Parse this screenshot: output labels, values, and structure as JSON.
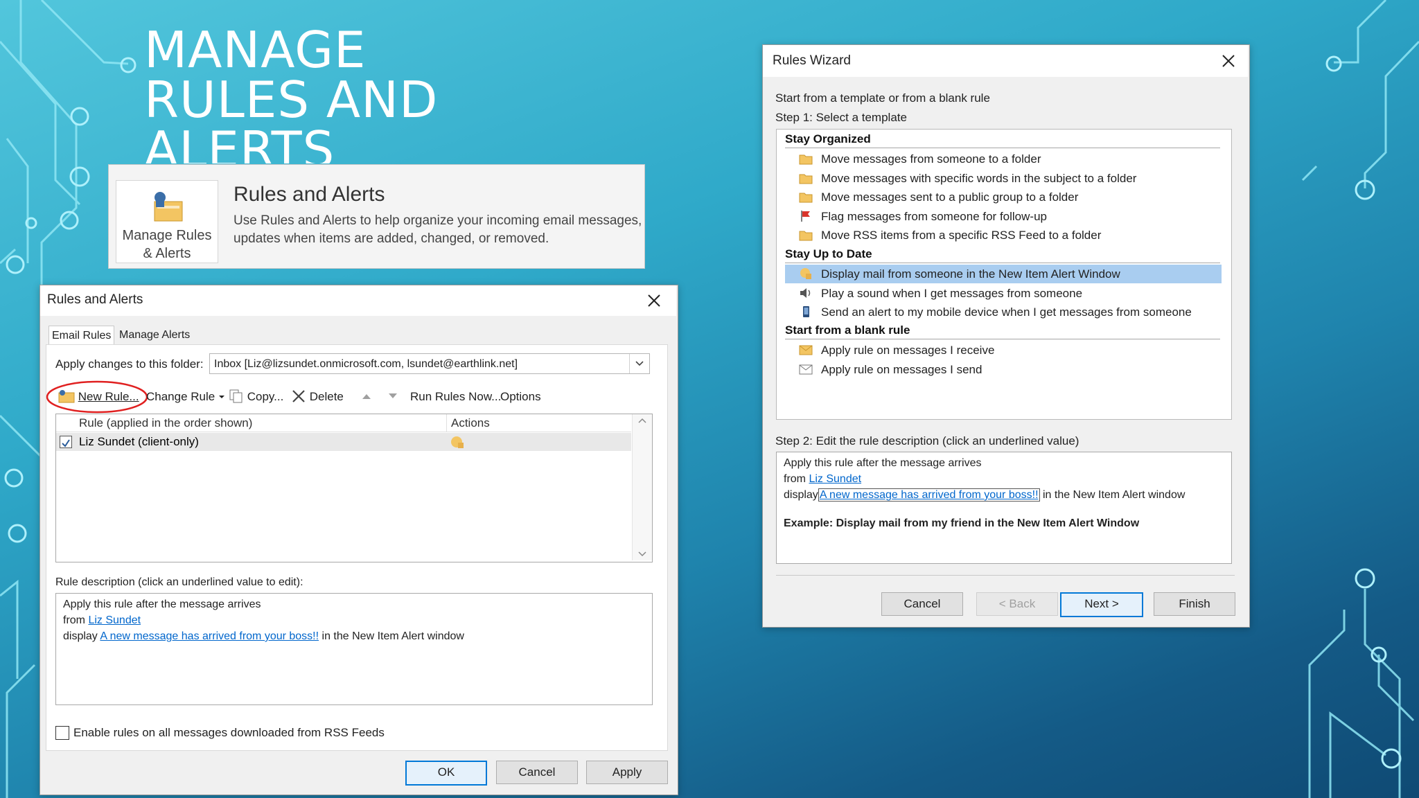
{
  "slide": {
    "title": "MANAGE\nRULES AND\nALERTS"
  },
  "ribbon": {
    "button_label": "Manage Rules\n& Alerts",
    "heading": "Rules and Alerts",
    "description": "Use Rules and Alerts to help organize your incoming email messages,\nupdates when items are added, changed, or removed."
  },
  "rules_alerts": {
    "title": "Rules and Alerts",
    "tabs": [
      "Email Rules",
      "Manage Alerts"
    ],
    "folder_label": "Apply changes to this folder:",
    "folder_value": "Inbox [Liz@lizsundet.onmicrosoft.com, lsundet@earthlink.net]",
    "toolbar": {
      "new_rule": "New Rule...",
      "change_rule": "Change Rule",
      "copy": "Copy...",
      "delete": "Delete",
      "run_rules": "Run Rules Now...",
      "options": "Options"
    },
    "columns": {
      "rule": "Rule (applied in the order shown)",
      "actions": "Actions"
    },
    "rules": [
      {
        "name": "Liz  Sundet  (client-only)",
        "checked": true
      }
    ],
    "description_label": "Rule description (click an underlined value to edit):",
    "description": {
      "line1": "Apply this rule after the message arrives",
      "from_prefix": "from",
      "from_link": "Liz  Sundet",
      "display_prefix": "display",
      "display_link": "A new message has arrived from your boss!!",
      "display_suffix": "in the New Item Alert window"
    },
    "rss_label": "Enable rules on all messages downloaded from RSS Feeds",
    "buttons": {
      "ok": "OK",
      "cancel": "Cancel",
      "apply": "Apply"
    }
  },
  "wizard": {
    "title": "Rules Wizard",
    "intro": "Start from a template or from a blank rule",
    "step1": "Step 1: Select a template",
    "groups": [
      {
        "name": "Stay Organized",
        "items": [
          {
            "label": "Move messages from someone to a folder",
            "icon": "folder-icon"
          },
          {
            "label": "Move messages with specific words in the subject to a folder",
            "icon": "folder-icon"
          },
          {
            "label": "Move messages sent to a public group to a folder",
            "icon": "folder-icon"
          },
          {
            "label": "Flag messages from someone for follow-up",
            "icon": "flag-icon"
          },
          {
            "label": "Move RSS items from a specific RSS Feed to a folder",
            "icon": "folder-icon"
          }
        ]
      },
      {
        "name": "Stay Up to Date",
        "items": [
          {
            "label": "Display mail from someone in the New Item Alert Window",
            "icon": "alert-icon",
            "selected": true
          },
          {
            "label": "Play a sound when I get messages from someone",
            "icon": "speaker-icon"
          },
          {
            "label": "Send an alert to my mobile device when I get messages from someone",
            "icon": "mobile-icon"
          }
        ]
      },
      {
        "name": "Start from a blank rule",
        "items": [
          {
            "label": "Apply rule on messages I receive",
            "icon": "envelope-icon"
          },
          {
            "label": "Apply rule on messages I send",
            "icon": "envelope-send-icon"
          }
        ]
      }
    ],
    "step2": "Step 2: Edit the rule description (click an underlined value)",
    "description": {
      "line1": "Apply this rule after the message arrives",
      "from_prefix": "from",
      "from_link": "Liz  Sundet",
      "display_prefix": "display",
      "display_link": "A new message has arrived from your boss!!",
      "display_suffix": "in the New Item Alert window"
    },
    "example": "Example: Display mail from my friend in the New Item Alert Window",
    "buttons": {
      "cancel": "Cancel",
      "back": "< Back",
      "next": "Next >",
      "finish": "Finish"
    }
  },
  "colors": {
    "accent": "#0078d7",
    "selection": "#a9cdf0",
    "link": "#0066cc",
    "highlight_circle": "#e02020"
  }
}
